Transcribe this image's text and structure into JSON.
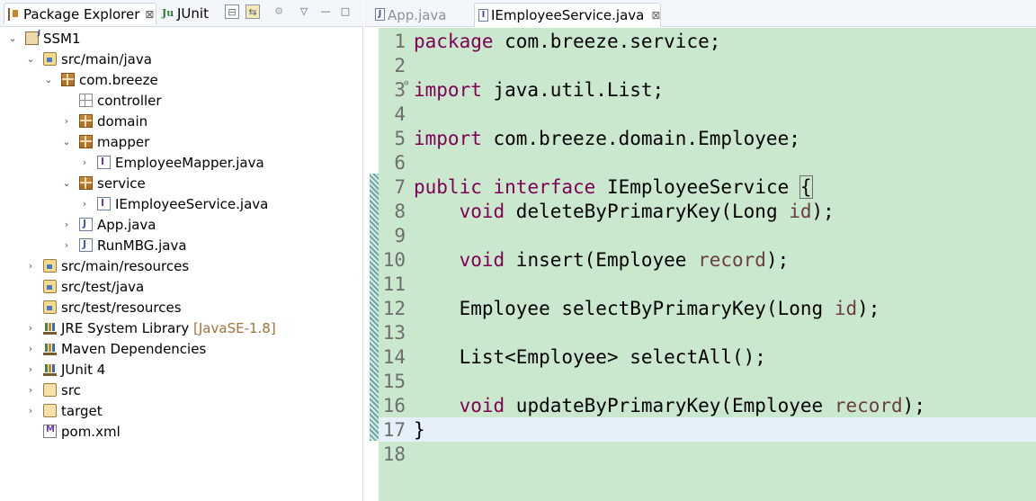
{
  "left_pane": {
    "tabs": [
      {
        "label": "Package Explorer",
        "close": "⊠"
      },
      {
        "label": "JUnit"
      }
    ],
    "toolbar": {
      "collapse_all": "⊟",
      "link_editor": "⇆",
      "focus": "⚙",
      "view_menu": "▽",
      "minimize": "—",
      "maximize": "□"
    },
    "tree": [
      {
        "label": "SSM1"
      },
      {
        "label": "src/main/java"
      },
      {
        "label": "com.breeze"
      },
      {
        "label": "controller"
      },
      {
        "label": "domain"
      },
      {
        "label": "mapper"
      },
      {
        "label": "EmployeeMapper.java"
      },
      {
        "label": "service"
      },
      {
        "label": "IEmployeeService.java"
      },
      {
        "label": "App.java"
      },
      {
        "label": "RunMBG.java"
      },
      {
        "label": "src/main/resources"
      },
      {
        "label": "src/test/java"
      },
      {
        "label": "src/test/resources"
      },
      {
        "label": "JRE System Library",
        "decoration": "[JavaSE-1.8]"
      },
      {
        "label": "Maven Dependencies"
      },
      {
        "label": "JUnit 4"
      },
      {
        "label": "src"
      },
      {
        "label": "target"
      },
      {
        "label": "pom.xml"
      }
    ],
    "twisty_expanded": "⌄",
    "twisty_collapsed": "›"
  },
  "editor": {
    "tabs": [
      {
        "label": "App.java",
        "icon": "J"
      },
      {
        "label": "IEmployeeService.java",
        "icon": "I",
        "close": "⊠"
      }
    ],
    "lines": [
      {
        "n": "1",
        "kw": "package",
        "text": " com.breeze.service;"
      },
      {
        "n": "2"
      },
      {
        "n": "3",
        "kw": "import",
        "text": " java.util.List;",
        "fold": "⊖"
      },
      {
        "n": "4"
      },
      {
        "n": "5",
        "kw": "import",
        "text": " com.breeze.domain.Employee;"
      },
      {
        "n": "6"
      },
      {
        "n": "7",
        "kw": "public",
        "kw2": "interface",
        "text": " IEmployeeService ",
        "brace": "{"
      },
      {
        "n": "8",
        "indent": "    ",
        "kw": "void",
        "text": " deleteByPrimaryKey(Long ",
        "param": "id",
        "tail": ");"
      },
      {
        "n": "9"
      },
      {
        "n": "10",
        "indent": "    ",
        "kw": "void",
        "text": " insert(Employee ",
        "param": "record",
        "tail": ");"
      },
      {
        "n": "11"
      },
      {
        "n": "12",
        "indent": "    ",
        "text": "Employee selectByPrimaryKey(Long ",
        "param": "id",
        "tail": ");"
      },
      {
        "n": "13"
      },
      {
        "n": "14",
        "indent": "    ",
        "text": "List<Employee> selectAll();"
      },
      {
        "n": "15"
      },
      {
        "n": "16",
        "indent": "    ",
        "kw": "void",
        "text": " updateByPrimaryKey(Employee ",
        "param": "record",
        "tail": ");"
      },
      {
        "n": "17",
        "text": "}",
        "current": true
      },
      {
        "n": "18"
      }
    ]
  },
  "colors": {
    "editor_background": "#cae8cd",
    "keyword": "#7f0055",
    "parameter": "#6a3e3e",
    "current_line": "#e6f0fb"
  }
}
